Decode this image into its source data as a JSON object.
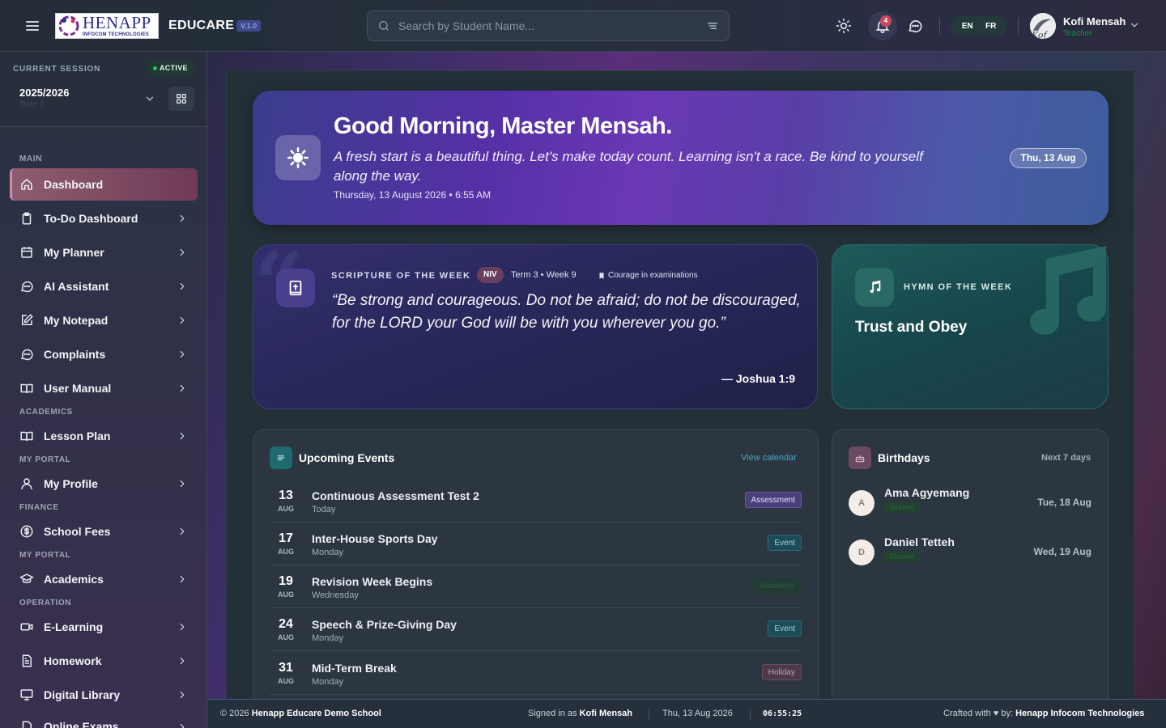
{
  "topbar": {
    "logo_main": "HENAPP",
    "logo_sub": "INFOCOM TECHNOLOGIES",
    "brand": "EDUCARE",
    "version": "V.1.0",
    "search_placeholder": "Search by Student Name...",
    "notification_count": "4",
    "lang_en": "EN",
    "lang_fr": "FR",
    "user_name": "Kofi Mensah",
    "user_role": "Teacher",
    "avatar_initials": "Kof"
  },
  "session": {
    "label": "CURRENT SESSION",
    "status": "ACTIVE",
    "year": "2025/2026",
    "term": "Term 3"
  },
  "nav": {
    "main": "MAIN",
    "academics": "ACADEMICS",
    "my_portal": "MY PORTAL",
    "finance": "FINANCE",
    "my_portal_2": "MY PORTAL",
    "operation": "OPERATION",
    "items": {
      "dashboard": "Dashboard",
      "todo": "To-Do Dashboard",
      "planner": "My Planner",
      "ai": "AI Assistant",
      "notepad": "My Notepad",
      "complaints": "Complaints",
      "manual": "User Manual",
      "lesson": "Lesson Plan",
      "profile": "My Profile",
      "fees": "School Fees",
      "academics": "Academics",
      "elearning": "E-Learning",
      "homework": "Homework",
      "library": "Digital Library",
      "exams": "Online Exams"
    }
  },
  "hero": {
    "greeting": "Good Morning, Master Mensah.",
    "message": "A fresh start is a beautiful thing. Let's make today count. Learning isn't a race. Be kind to yourself along the way.",
    "datetime": "Thursday, 13 August 2026 • 6:55 AM",
    "date_pill": "Thu, 13 Aug"
  },
  "scripture": {
    "label": "SCRIPTURE OF THE WEEK",
    "version": "NIV",
    "term_week": "Term 3 • Week 9",
    "topic": "Courage in examinations",
    "text": "“Be strong and courageous. Do not be afraid; do not be discouraged, for the LORD your God will be with you wherever you go.”",
    "reference": "— Joshua 1:9"
  },
  "hymn": {
    "label": "HYMN OF THE WEEK",
    "title": "Trust and Obey"
  },
  "events": {
    "title": "Upcoming Events",
    "link": "View calendar",
    "items": [
      {
        "day": "13",
        "month": "AUG",
        "name": "Continuous Assessment Test 2",
        "when": "Today",
        "tag": "Assessment"
      },
      {
        "day": "17",
        "month": "AUG",
        "name": "Inter-House Sports Day",
        "when": "Monday",
        "tag": "Event"
      },
      {
        "day": "19",
        "month": "AUG",
        "name": "Revision Week Begins",
        "when": "Wednesday",
        "tag": "Academic"
      },
      {
        "day": "24",
        "month": "AUG",
        "name": "Speech & Prize-Giving Day",
        "when": "Monday",
        "tag": "Event"
      },
      {
        "day": "31",
        "month": "AUG",
        "name": "Mid-Term Break",
        "when": "Monday",
        "tag": "Holiday"
      }
    ]
  },
  "birthdays": {
    "title": "Birthdays",
    "range": "Next 7 days",
    "items": [
      {
        "initial": "A",
        "name": "Ama Agyemang",
        "role": "Student",
        "date": "Tue, 18 Aug"
      },
      {
        "initial": "D",
        "name": "Daniel Tetteh",
        "role": "Student",
        "date": "Wed, 19 Aug"
      }
    ]
  },
  "footer": {
    "copyright": "© 2026",
    "school": "Henapp Educare Demo School",
    "signed_prefix": "Signed in as",
    "signed_user": "Kofi Mensah",
    "date": "Thu, 13 Aug 2026",
    "clock": "06:55:25",
    "crafted_prefix": "Crafted with",
    "crafted_by": "by:",
    "company": "Henapp Infocom Technologies"
  },
  "colors": {
    "accent": "#6a38b4",
    "active_nav": "#8e5c72",
    "hymn": "#1e5a5a",
    "success": "#2dbf6a"
  }
}
